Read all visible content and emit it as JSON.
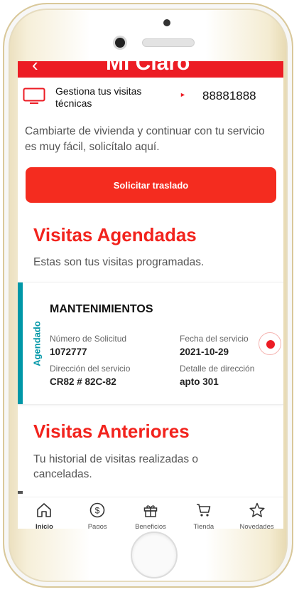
{
  "header": {
    "back_icon": "‹",
    "title": "Mi Claro"
  },
  "tech_visits": {
    "label": "Gestiona tus visitas técnicas",
    "arrow": "►",
    "phone": "88881888",
    "icon": "tv-icon"
  },
  "move": {
    "text": "Cambiarte de vivienda y continuar con tu servicio es muy fácil, solicítalo aquí.",
    "button_label": "Solicitar traslado"
  },
  "scheduled": {
    "title": "Visitas Agendadas",
    "subtitle": "Estas son tus visitas programadas.",
    "visit": {
      "status": "Agendado",
      "type": "MANTENIMIENTOS",
      "request_label": "Número de Solicitud",
      "request_value": "1072777",
      "date_label": "Fecha del servicio",
      "date_value": "2021-10-29",
      "address_label": "Dirección del servicio",
      "address_value": "CR82 # 82C-82",
      "detail_label": "Detalle de dirección",
      "detail_value": "apto 301"
    }
  },
  "previous": {
    "title": "Visitas Anteriores",
    "subtitle": "Tu historial de visitas realizadas o canceladas."
  },
  "nav": [
    {
      "label": "Inicio",
      "icon": "home-icon",
      "active": true
    },
    {
      "label": "Pagos",
      "icon": "dollar-icon"
    },
    {
      "label": "Beneficios",
      "icon": "gift-icon"
    },
    {
      "label": "Tienda",
      "icon": "cart-icon"
    },
    {
      "label": "Novedades",
      "icon": "star-icon"
    }
  ],
  "colors": {
    "brand_red": "#ec1c24",
    "status_teal": "#0097a7"
  }
}
